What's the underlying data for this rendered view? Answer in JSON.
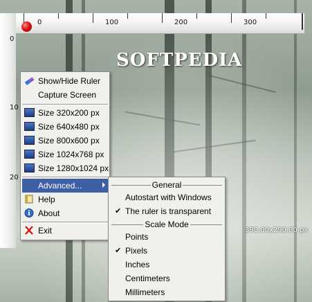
{
  "background": {
    "watermark": "SOFTPEDIA",
    "coord_readout": "390.00x290.00 px"
  },
  "ruler": {
    "h_labels": [
      "0",
      "100",
      "200",
      "300"
    ],
    "v_labels": [
      "0",
      "10",
      "20"
    ]
  },
  "menu": {
    "items": [
      {
        "label": "Show/Hide Ruler",
        "icon": "ruler-icon"
      },
      {
        "label": "Capture Screen",
        "icon": ""
      },
      {
        "label": "Size 320x200 px",
        "icon": "monitor-icon"
      },
      {
        "label": "Size 640x480 px",
        "icon": "monitor-icon"
      },
      {
        "label": "Size 800x600 px",
        "icon": "monitor-icon"
      },
      {
        "label": "Size 1024x768 px",
        "icon": "monitor-icon"
      },
      {
        "label": "Size 1280x1024 px",
        "icon": "monitor-icon"
      },
      {
        "label": "Advanced...",
        "icon": "",
        "highlighted": true
      },
      {
        "label": "Help",
        "icon": "help-icon"
      },
      {
        "label": "About",
        "icon": "info-icon"
      },
      {
        "label": "Exit",
        "icon": "close-icon"
      }
    ]
  },
  "submenu": {
    "general_header": "General",
    "autostart": "Autostart with Windows",
    "transparent": "The ruler is transparent",
    "scale_header": "Scale Mode",
    "points": "Points",
    "pixels": "Pixels",
    "inches": "Inches",
    "centimeters": "Centimeters",
    "millimeters": "Millimeters",
    "checked": [
      "transparent",
      "pixels"
    ]
  },
  "colors": {
    "highlight": "#3e5fa4",
    "menu_bg": "#f0f0ec"
  }
}
